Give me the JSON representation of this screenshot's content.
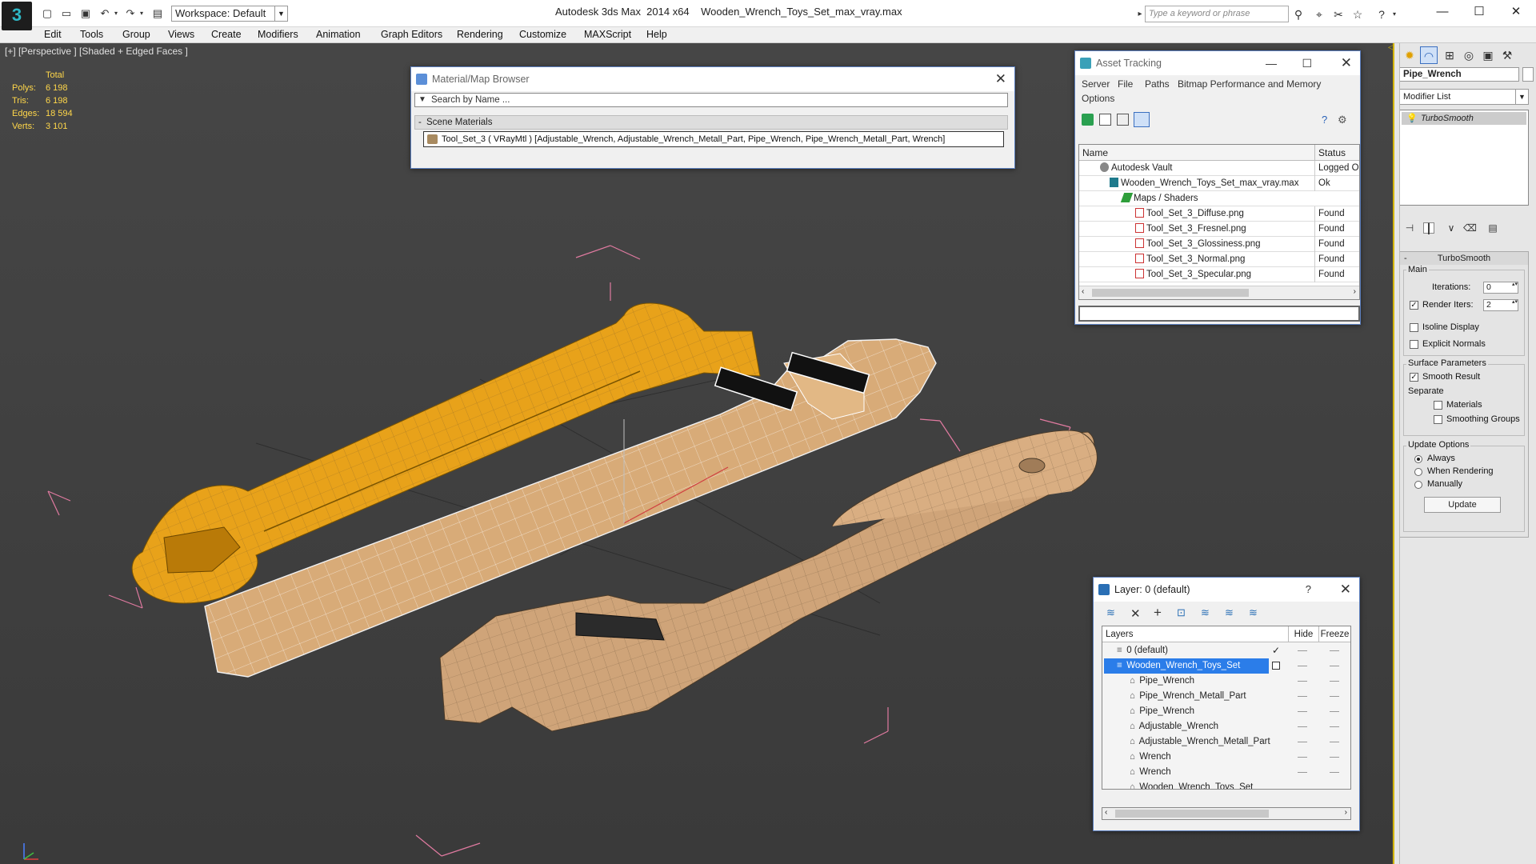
{
  "titlebar": {
    "app_title": "Autodesk 3ds Max  2014 x64",
    "file_name": "Wooden_Wrench_Toys_Set_max_vray.max",
    "workspace": "Workspace: Default",
    "search_placeholder": "Type a keyword or phrase"
  },
  "menu": [
    "Edit",
    "Tools",
    "Group",
    "Views",
    "Create",
    "Modifiers",
    "Animation",
    "Graph Editors",
    "Rendering",
    "Customize",
    "MAXScript",
    "Help"
  ],
  "viewport": {
    "label": "[+] [Perspective ] [Shaded + Edged Faces ]",
    "stats": {
      "header": "Total",
      "rows": [
        {
          "label": "Polys:",
          "value": "6 198"
        },
        {
          "label": "Tris:",
          "value": "6 198"
        },
        {
          "label": "Edges:",
          "value": "18 594"
        },
        {
          "label": "Verts:",
          "value": "3 101"
        }
      ]
    }
  },
  "material_browser": {
    "title": "Material/Map Browser",
    "search_placeholder": "Search by Name ...",
    "section": "Scene Materials",
    "item": "Tool_Set_3  ( VRayMtl ) [Adjustable_Wrench, Adjustable_Wrench_Metall_Part, Pipe_Wrench, Pipe_Wrench_Metall_Part, Wrench]"
  },
  "asset_tracking": {
    "title": "Asset Tracking",
    "menu": [
      "Server",
      "File",
      "Paths",
      "Bitmap Performance and Memory",
      "Options"
    ],
    "columns": {
      "name": "Name",
      "status": "Status"
    },
    "rows": [
      {
        "name": "Autodesk Vault",
        "status": "Logged Out",
        "icon": "vault-icon"
      },
      {
        "name": "Wooden_Wrench_Toys_Set_max_vray.max",
        "status": "Ok",
        "icon": "max-file-icon"
      },
      {
        "name": "Maps / Shaders",
        "status": "",
        "icon": "maps-icon"
      },
      {
        "name": "Tool_Set_3_Diffuse.png",
        "status": "Found",
        "icon": "png-icon"
      },
      {
        "name": "Tool_Set_3_Fresnel.png",
        "status": "Found",
        "icon": "png-icon"
      },
      {
        "name": "Tool_Set_3_Glossiness.png",
        "status": "Found",
        "icon": "png-icon"
      },
      {
        "name": "Tool_Set_3_Normal.png",
        "status": "Found",
        "icon": "png-icon"
      },
      {
        "name": "Tool_Set_3_Specular.png",
        "status": "Found",
        "icon": "png-icon"
      }
    ]
  },
  "layer_dialog": {
    "title": "Layer: 0 (default)",
    "help": "?",
    "columns": {
      "layers": "Layers",
      "hide": "Hide",
      "freeze": "Freeze"
    },
    "rows": [
      {
        "name": "0 (default)",
        "level": 0
      },
      {
        "name": "Wooden_Wrench_Toys_Set",
        "level": 0,
        "selected": true
      },
      {
        "name": "Pipe_Wrench",
        "level": 1
      },
      {
        "name": "Pipe_Wrench_Metall_Part",
        "level": 1
      },
      {
        "name": "Pipe_Wrench",
        "level": 1
      },
      {
        "name": "Adjustable_Wrench",
        "level": 1
      },
      {
        "name": "Adjustable_Wrench_Metall_Part",
        "level": 1
      },
      {
        "name": "Wrench",
        "level": 1
      },
      {
        "name": "Wrench",
        "level": 1
      },
      {
        "name": "Wooden_Wrench_Toys_Set",
        "level": 1
      }
    ]
  },
  "command_panel": {
    "object_name": "Pipe_Wrench",
    "modifier_list": "Modifier List",
    "stack_item": "TurboSmooth",
    "turbosmooth": {
      "title": "TurboSmooth",
      "main": "Main",
      "iterations_label": "Iterations:",
      "iterations": "0",
      "render_iters_label": "Render Iters:",
      "render_iters": "2",
      "isoline": "Isoline Display",
      "explicit_normals": "Explicit Normals",
      "surface_params": "Surface Parameters",
      "smooth_result": "Smooth Result",
      "separate": "Separate",
      "materials": "Materials",
      "smoothing_groups": "Smoothing Groups",
      "update_options": "Update Options",
      "always": "Always",
      "when_rendering": "When Rendering",
      "manually": "Manually",
      "update_button": "Update"
    }
  },
  "colors": {
    "selection": "#2b7de9",
    "wood_light": "#d8ab78",
    "wood_selected": "#e8a21a",
    "stats_text": "#ffd74a",
    "bbox": "#e07aa0"
  }
}
